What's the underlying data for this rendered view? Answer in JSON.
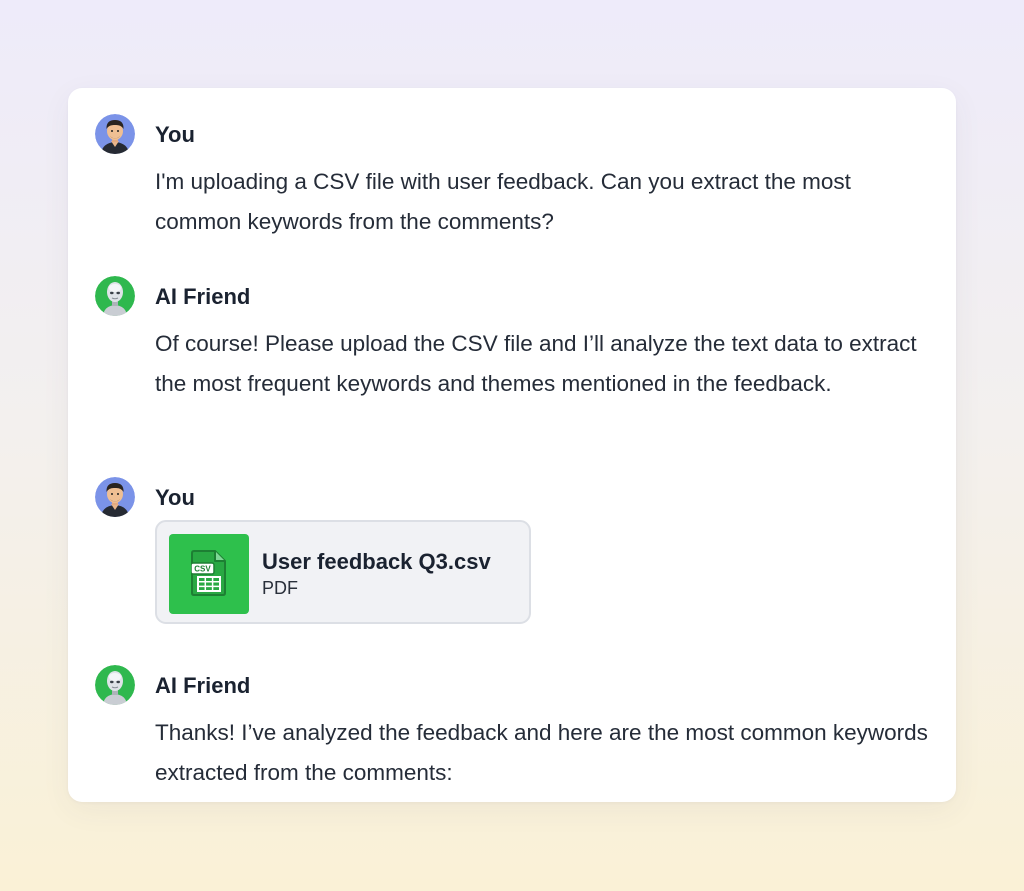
{
  "messages": [
    {
      "author": "You",
      "avatar_icon": "user-avatar-icon",
      "text": "I'm uploading a CSV file with user feedback. Can you extract the most common keywords from the comments?"
    },
    {
      "author": "AI Friend",
      "avatar_icon": "robot-avatar-icon",
      "text": "Of course! Please upload the CSV file and I’ll analyze the text data to extract the most frequent keywords and themes mentioned in the feedback."
    },
    {
      "author": "You",
      "avatar_icon": "user-avatar-icon",
      "attachment": {
        "name": "User feedback Q3.csv",
        "type": "PDF",
        "icon": "csv-file-icon",
        "icon_label": "CSV"
      }
    },
    {
      "author": "AI Friend",
      "avatar_icon": "robot-avatar-icon",
      "text": "Thanks! I’ve analyzed the feedback and here are the most common keywords extracted from the comments:"
    }
  ],
  "colors": {
    "user_avatar_bg": "#7b93e8",
    "ai_avatar_bg": "#2fb84e",
    "file_icon_bg": "#2ec04c"
  }
}
